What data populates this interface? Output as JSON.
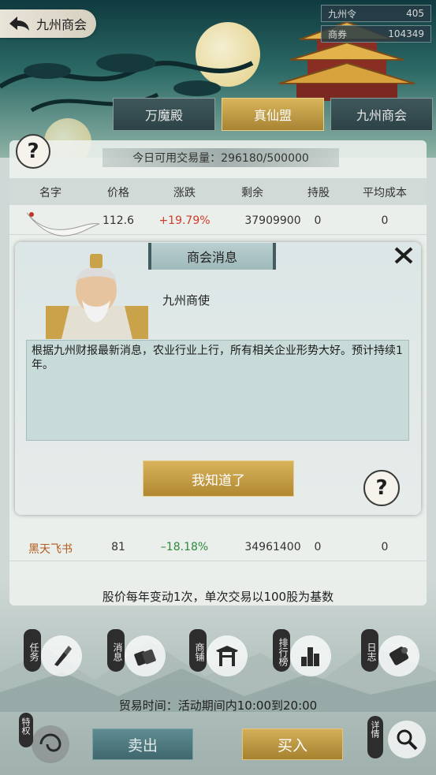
{
  "header": {
    "title": "九州商会",
    "currencies": [
      {
        "label": "九州令",
        "value": "405"
      },
      {
        "label": "商券",
        "value": "104349"
      }
    ]
  },
  "tabs": [
    {
      "label": "万魔殿",
      "active": false
    },
    {
      "label": "真仙盟",
      "active": true
    },
    {
      "label": "九州商会",
      "active": false
    }
  ],
  "volume": {
    "text": "今日可用交易量：296180/500000"
  },
  "table": {
    "headers": [
      "名字",
      "价格",
      "涨跌",
      "剩余",
      "持股",
      "平均成本"
    ],
    "rows": [
      {
        "name": "",
        "price": "112.6",
        "change": "+19.79%",
        "remaining": "37909900",
        "held": "0",
        "avg_cost": "0",
        "trend": "up"
      },
      {
        "name": "黑天飞书",
        "price": "81",
        "change": "–18.18%",
        "remaining": "34961400",
        "held": "0",
        "avg_cost": "0",
        "trend": "down"
      }
    ]
  },
  "rule_text": "股价每年变动1次，单次交易以100股为基数",
  "nav": [
    {
      "badge": "任务",
      "icon": "brush-icon"
    },
    {
      "badge": "消息",
      "icon": "scroll-icon"
    },
    {
      "badge": "商铺",
      "icon": "shop-gate-icon"
    },
    {
      "badge": "排行榜",
      "icon": "bar-chart-icon"
    },
    {
      "badge": "日志",
      "icon": "log-scroll-icon"
    }
  ],
  "trade_time": "贸易时间：活动期间内10:00到20:00",
  "buttons": {
    "sell": "卖出",
    "buy": "买入",
    "perk": "特权",
    "detail": "详情"
  },
  "dialog": {
    "title": "商会消息",
    "speaker": "九州商使",
    "message": "根据九州财报最新消息，农业行业上行，所有相关企业形势大好。预计持续1年。",
    "confirm": "我知道了"
  },
  "colors": {
    "accent_gold": "#c9a24a",
    "up": "#d23a2a",
    "down": "#2c8a3a",
    "teal": "#40686e"
  }
}
